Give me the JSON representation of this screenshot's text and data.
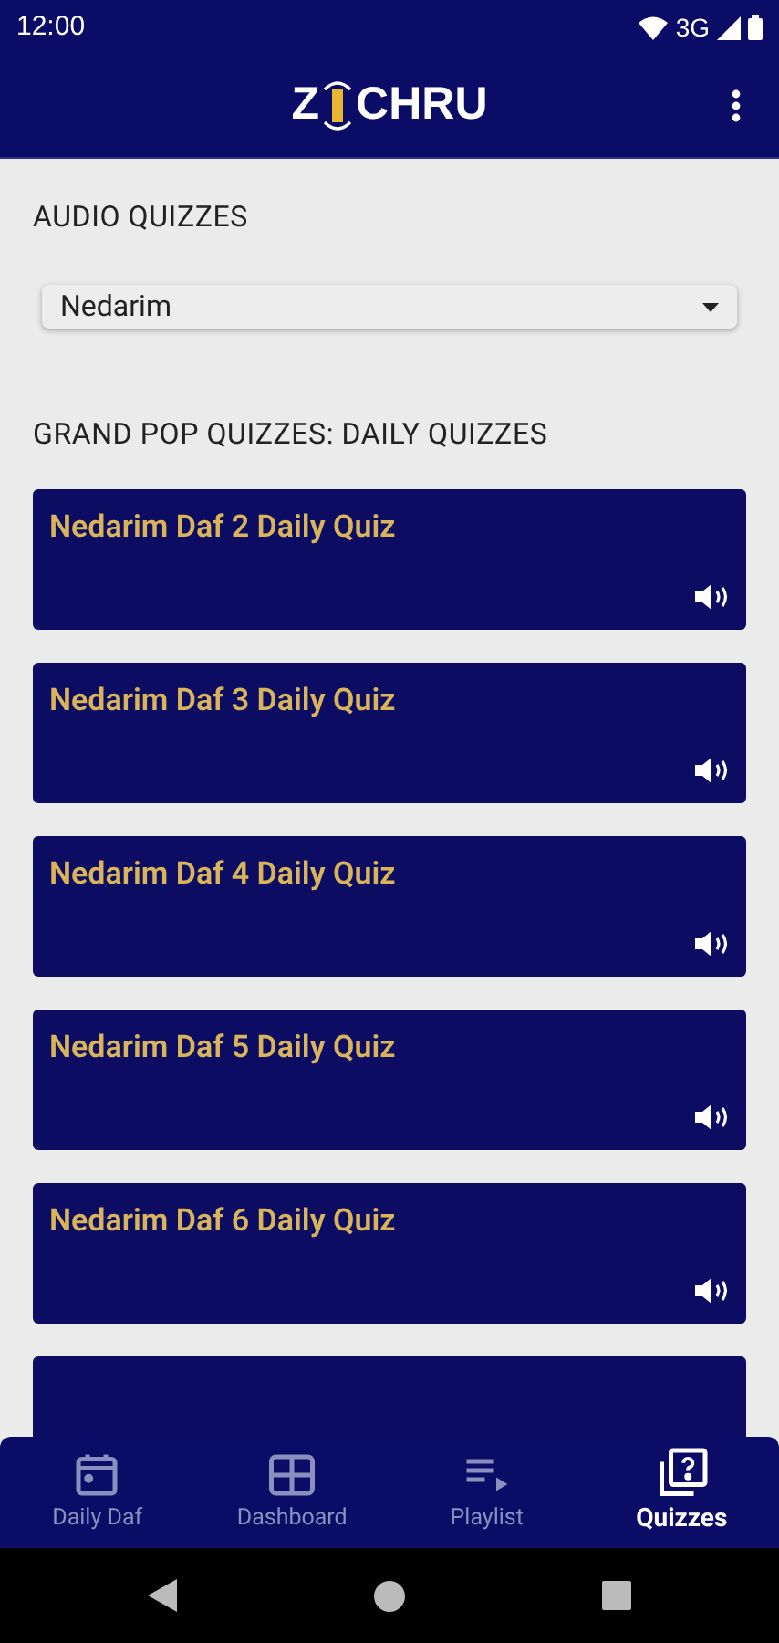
{
  "status_bar": {
    "time": "12:00",
    "network": "3G"
  },
  "app_bar": {
    "logo": {
      "left": "Z",
      "right": "CHRU"
    }
  },
  "audio_section": {
    "heading": "AUDIO QUIZZES",
    "dropdown": {
      "value": "Nedarim"
    }
  },
  "quiz_section": {
    "heading": "GRAND POP QUIZZES: DAILY QUIZZES",
    "quizzes": [
      {
        "title": "Nedarim Daf 2 Daily Quiz"
      },
      {
        "title": "Nedarim Daf 3 Daily Quiz"
      },
      {
        "title": "Nedarim Daf 4 Daily Quiz"
      },
      {
        "title": "Nedarim Daf 5 Daily Quiz"
      },
      {
        "title": "Nedarim Daf 6 Daily Quiz"
      }
    ]
  },
  "bottom_nav": [
    {
      "label": "Daily Daf",
      "kind": "calendar",
      "selected": false
    },
    {
      "label": "Dashboard",
      "kind": "grid",
      "selected": false
    },
    {
      "label": "Playlist",
      "kind": "playlist",
      "selected": false
    },
    {
      "label": "Quizzes",
      "kind": "quiz",
      "selected": true
    }
  ]
}
